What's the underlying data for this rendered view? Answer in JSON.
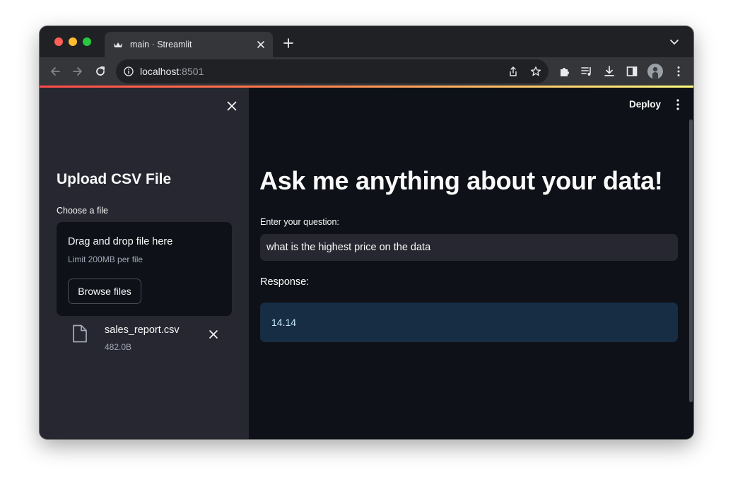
{
  "browser": {
    "tab_title": "main · Streamlit",
    "url_host": "localhost",
    "url_port": ":8501"
  },
  "app": {
    "deploy_label": "Deploy",
    "main_title": "Ask me anything about your data!",
    "question_label": "Enter your question:",
    "question_value": "what is the highest price on the data",
    "response_label": "Response:",
    "response_value": "14.14"
  },
  "sidebar": {
    "heading": "Upload CSV File",
    "uploader_label": "Choose a file",
    "dropzone_title": "Drag and drop file here",
    "dropzone_limit": "Limit 200MB per file",
    "browse_label": "Browse files",
    "uploaded_file": {
      "name": "sales_report.csv",
      "size": "482.0B"
    }
  },
  "colors": {
    "app_bg": "#0e1117",
    "sidebar_bg": "#262730",
    "response_bg": "#172d43",
    "accent_red": "#ff4b4b"
  },
  "icons": [
    "streamlit-favicon-icon",
    "close-icon",
    "plus-icon",
    "chevron-down-icon",
    "back-arrow-icon",
    "forward-arrow-icon",
    "reload-icon",
    "info-icon",
    "share-icon",
    "star-icon",
    "extensions-icon",
    "media-icon",
    "download-icon",
    "sidepanel-icon",
    "kebab-menu-icon",
    "file-icon"
  ]
}
